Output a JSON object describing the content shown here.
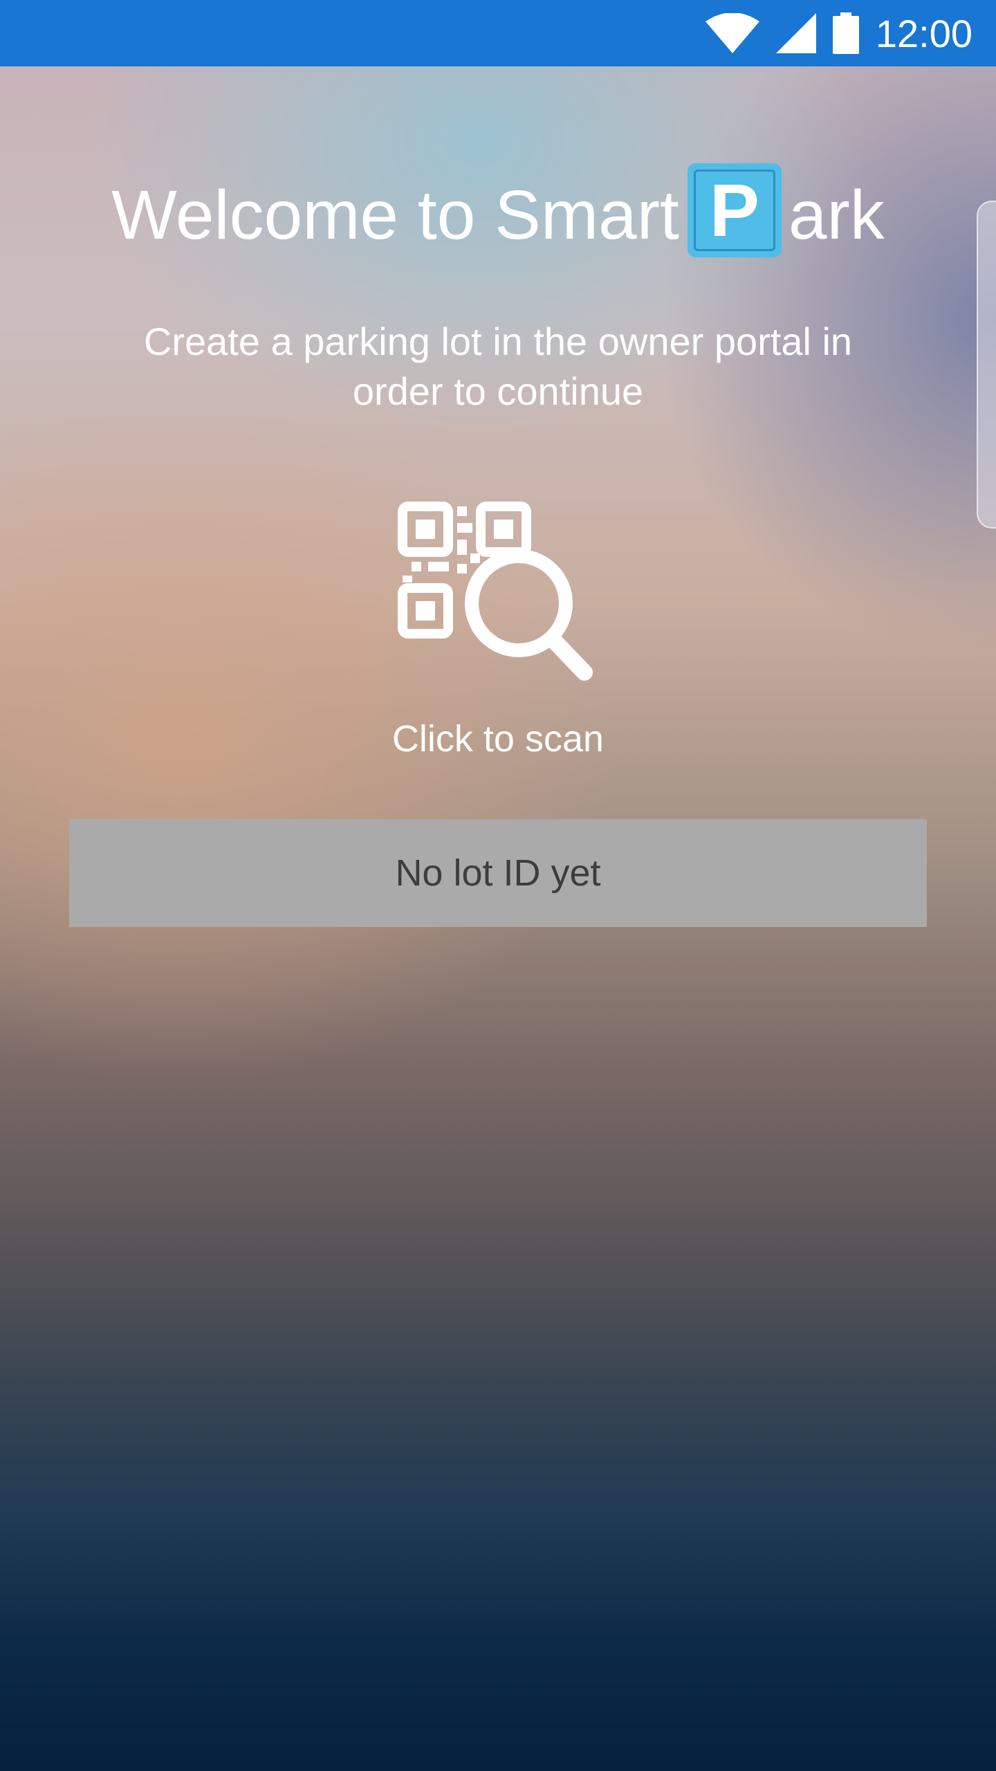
{
  "status_bar": {
    "time": "12:00",
    "icons": [
      "wifi-icon",
      "cell-signal-icon",
      "battery-icon"
    ],
    "background": "#1976d2"
  },
  "welcome": {
    "title_prefix": "Welcome to Smart",
    "logo_letter": "P",
    "title_suffix": "ark",
    "logo_color": "#4fbde8"
  },
  "instructions": {
    "text": "Create a parking lot in the owner portal in order to continue"
  },
  "scanner": {
    "icon": "qr-scan-icon",
    "label": "Click to scan"
  },
  "lot": {
    "status": "No lot ID yet"
  }
}
